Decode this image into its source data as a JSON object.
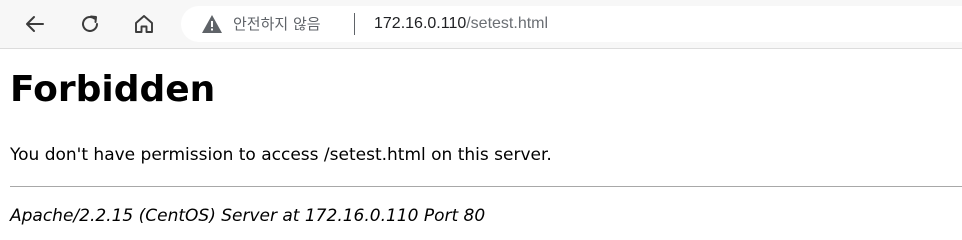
{
  "browser": {
    "security_label": "안전하지 않음",
    "url_host": "172.16.0.110",
    "url_path": "/setest.html",
    "icons": {
      "back": "back-arrow-icon",
      "refresh": "refresh-icon",
      "home": "home-icon",
      "warning": "warning-icon"
    }
  },
  "page": {
    "heading": "Forbidden",
    "message": "You don't have permission to access /setest.html on this server.",
    "server_signature": "Apache/2.2.15 (CentOS) Server at 172.16.0.110 Port 80"
  }
}
